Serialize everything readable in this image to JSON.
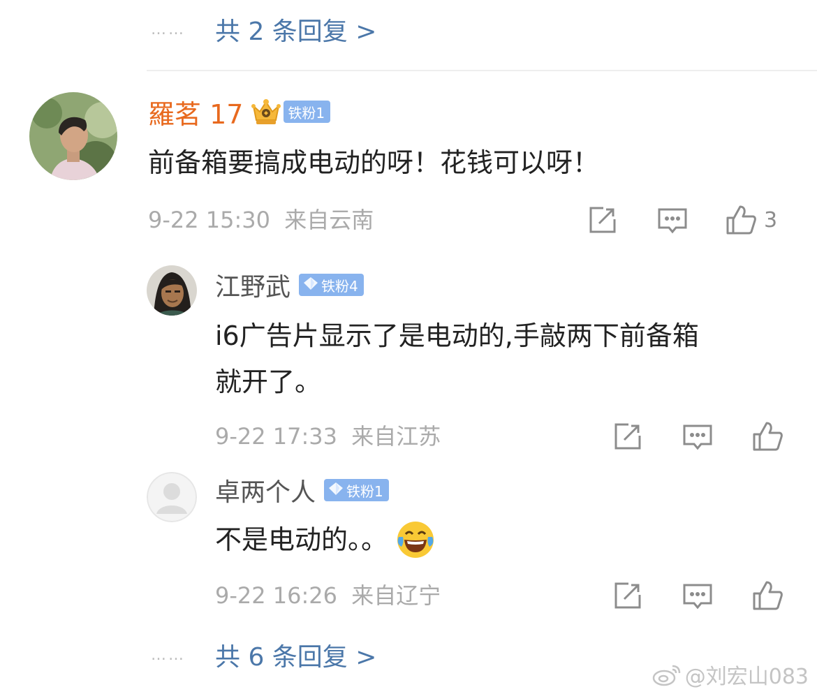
{
  "top_replies": {
    "dots": "……",
    "label": "共 2 条回复 >"
  },
  "main_comment": {
    "username": "羅茗 17",
    "badge": "铁粉1",
    "text": "前备箱要搞成电动的呀！花钱可以呀！",
    "time": "9-22 15:30",
    "location": "来自云南",
    "likes": "3"
  },
  "replies": [
    {
      "username": "江野武",
      "badge": "铁粉4",
      "text_line1": "i6广告片显示了是电动的,手敲两下前备箱",
      "text_line2": "就开了。",
      "time": "9-22 17:33",
      "location": "来自江苏"
    },
    {
      "username": "卓两个人",
      "badge": "铁粉1",
      "text": "不是电动的。。",
      "time": "9-22 16:26",
      "location": "来自辽宁"
    }
  ],
  "bottom_replies": {
    "dots": "……",
    "label": "共 6 条回复 >"
  },
  "watermark": {
    "text": "@刘宏山083"
  },
  "colors": {
    "link": "#4b77a9",
    "vip_name": "#e8691e",
    "badge_bg": "#88b3ee",
    "meta": "#aaaaaa"
  },
  "icons": [
    "share-icon",
    "comment-icon",
    "thumbs-up-icon",
    "diamond-icon",
    "crown-icon",
    "laughing-tears-emoji-icon",
    "weibo-logo-icon"
  ]
}
